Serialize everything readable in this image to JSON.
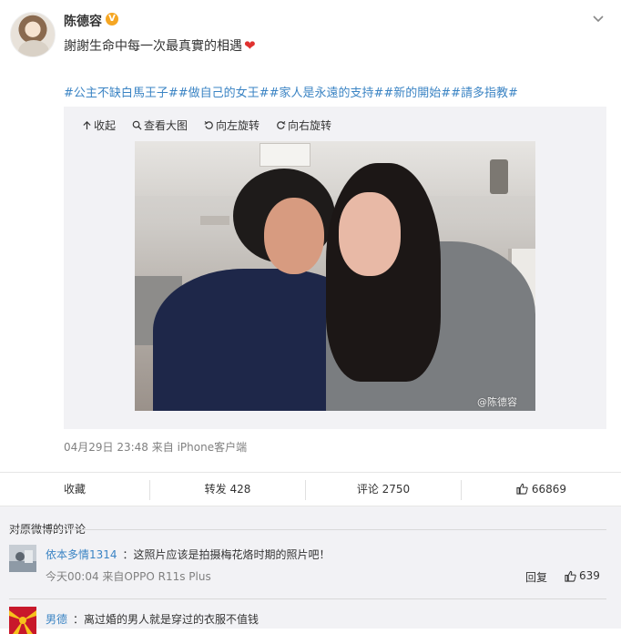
{
  "post": {
    "username": "陈德容",
    "verified_badge": "V",
    "text": "謝謝生命中每一次最真實的相遇",
    "heart": "❤",
    "hashtags": "#公主不缺白馬王子##做自己的女王##家人是永遠的支持##新的開始##請多指教#",
    "media_toolbar": {
      "collapse": "收起",
      "view_large": "查看大图",
      "rotate_left": "向左旋转",
      "rotate_right": "向右旋转"
    },
    "photo_watermark": "@陈德容",
    "timestamp": "04月29日 23:48",
    "source": "来自 iPhone客户端"
  },
  "actions": {
    "favorite": "收藏",
    "repost": "转发 428",
    "comment": "评论 2750",
    "like_count": "66869"
  },
  "comments": {
    "title": "对原微博的评论",
    "items": [
      {
        "name": "依本多情1314",
        "text": "：这照片应该是拍摄梅花烙时期的照片吧！",
        "time": "今天00:04",
        "source": "来自OPPO R11s Plus",
        "reply": "回复",
        "likes": "639"
      },
      {
        "name": "男德",
        "text": "：离过婚的男人就是穿过的衣服不值钱"
      }
    ]
  },
  "colors": {
    "link_blue": "#3b84c4",
    "verified_orange": "#f5a623",
    "heart_red": "#e0312f",
    "panel_gray": "#f2f2f5"
  }
}
